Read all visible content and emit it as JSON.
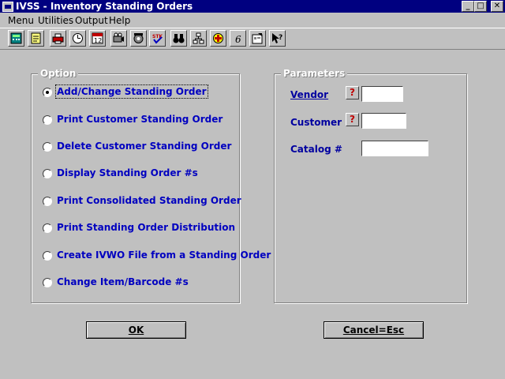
{
  "window": {
    "title": "IVSS - Inventory Standing Orders"
  },
  "menu": [
    "Menu",
    "Utilities",
    "Output",
    "Help"
  ],
  "toolbar_icons": [
    "calculator-icon",
    "notepad-icon",
    "printer-icon",
    "clock-icon",
    "calendar-icon",
    "projector-icon",
    "phone-icon",
    "stk-check-icon",
    "binoculars-icon",
    "network-icon",
    "plus-icon",
    "six-icon",
    "properties-icon",
    "help-pointer-icon"
  ],
  "option_group": {
    "legend": "Option",
    "options": [
      "Add/Change Standing Order",
      "Print Customer Standing Order",
      "Delete Customer Standing Order",
      "Display Standing Order #s",
      "Print Consolidated Standing Order",
      "Print Standing Order Distribution",
      "Create IVWO File from a Standing Order",
      "Change Item/Barcode #s"
    ],
    "selected_index": 0
  },
  "parameters_group": {
    "legend": "Parameters",
    "vendor_label": "Vendor",
    "customer_label": "Customer #",
    "catalog_label": "Catalog #",
    "vendor_value": "",
    "customer_value": "",
    "catalog_value": "",
    "lookup_glyph": "?"
  },
  "buttons": {
    "ok": "OK",
    "cancel": "Cancel=Esc"
  },
  "colors": {
    "titlebar": "#000080",
    "label_blue": "#0000c0",
    "face": "#c0c0c0"
  }
}
